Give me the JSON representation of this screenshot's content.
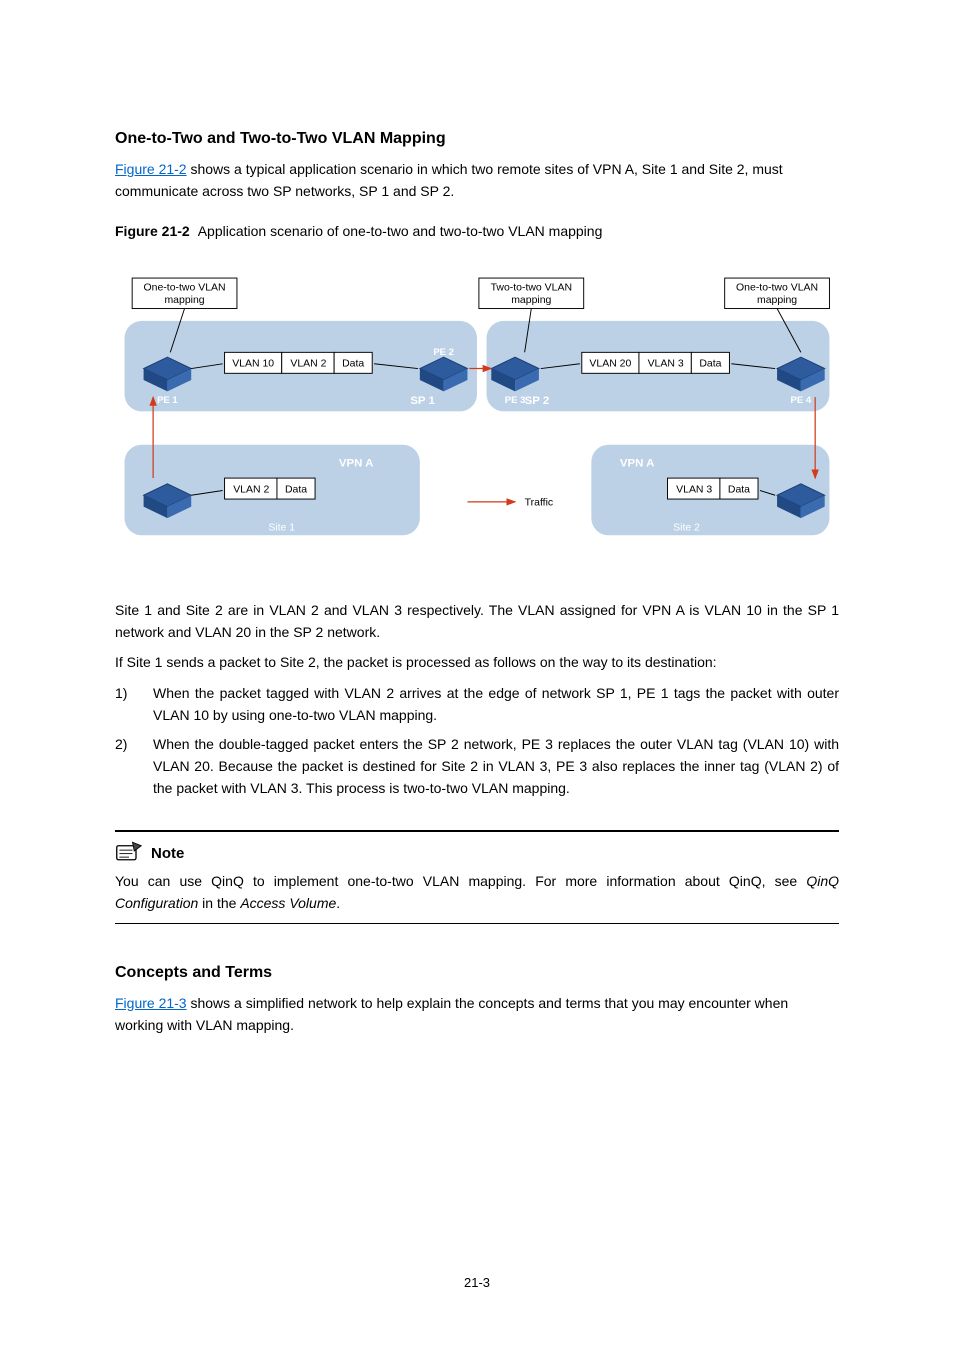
{
  "section_header": "One-to-Two and Two-to-Two VLAN Mapping",
  "intro": {
    "link_text": "Figure 21-2",
    "rest": " shows a typical application scenario in which two remote sites of VPN A, Site 1 and Site 2, must communicate across two SP networks, SP 1 and SP 2."
  },
  "figure": {
    "label": "Figure 21-2",
    "title": "Application scenario of one-to-two and two-to-two VLAN mapping"
  },
  "diagram": {
    "box1": {
      "l1": "One-to-two VLAN",
      "l2": "mapping"
    },
    "box2": {
      "l1": "Two-to-two VLAN",
      "l2": "mapping"
    },
    "box3": {
      "l1": "One-to-two VLAN",
      "l2": "mapping"
    },
    "pkt1": {
      "a": "VLAN 10",
      "b": "VLAN 2",
      "c": "Data"
    },
    "pkt2": {
      "a": "VLAN 20",
      "b": "VLAN 3",
      "c": "Data"
    },
    "pkt3": {
      "a": "VLAN 2",
      "b": "Data"
    },
    "pkt4": {
      "a": "VLAN 3",
      "b": "Data"
    },
    "sp1": "SP 1",
    "sp2": "SP 2",
    "vpnA1": "VPN A",
    "vpnA2": "VPN A",
    "pe1": "PE 1",
    "pe2": "PE 2",
    "pe3": "PE 3",
    "pe4": "PE 4",
    "site1": "Site 1",
    "site2": "Site 2",
    "traffic": "Traffic"
  },
  "after_fig": {
    "p1": "Site 1 and Site 2 are in VLAN 2 and VLAN 3 respectively. The VLAN assigned for VPN A is VLAN 10 in the SP 1 network and VLAN 20 in the SP 2 network.",
    "p2": "If Site 1 sends a packet to Site 2, the packet is processed as follows on the way to its destination:",
    "li1": "When the packet tagged with VLAN 2 arrives at the edge of network SP 1, PE 1 tags the packet with outer VLAN 10 by using one-to-two VLAN mapping.",
    "li2": "When the double-tagged packet enters the SP 2 network, PE 3 replaces the outer VLAN tag (VLAN 10) with VLAN 20. Because the packet is destined for Site 2 in VLAN 3, PE 3 also replaces the inner tag (VLAN 2) of the packet with VLAN 3. This process is two-to-two VLAN mapping."
  },
  "note": {
    "title": "Note",
    "body_pre": "You can use QinQ to implement one-to-two VLAN mapping. For more information about QinQ, see ",
    "body_italic1": "QinQ Configuration",
    "body_mid": " in the ",
    "body_italic2": "Access Volume",
    "body_post": "."
  },
  "concepts": {
    "header": "Concepts and Terms",
    "link_text": "Figure 21-3",
    "rest": " shows a simplified network to help explain the concepts and terms that you may encounter when working with VLAN mapping."
  },
  "page_num": "21-3",
  "chart_data": {
    "type": "diagram",
    "topology": {
      "upper_row": {
        "left_cloud": "SP 1",
        "right_cloud": "SP 2",
        "devices": [
          "PE 1",
          "PE 2",
          "PE 3",
          "PE 4"
        ],
        "callouts": [
          {
            "target": "PE 1",
            "text": "One-to-two VLAN mapping"
          },
          {
            "target": "PE 3",
            "text": "Two-to-two VLAN mapping"
          },
          {
            "target": "PE 4",
            "text": "One-to-two VLAN mapping"
          }
        ],
        "packets": [
          {
            "between": [
              "PE 1",
              "PE 2"
            ],
            "tags": [
              "VLAN 10",
              "VLAN 2",
              "Data"
            ]
          },
          {
            "between": [
              "PE 3",
              "PE 4"
            ],
            "tags": [
              "VLAN 20",
              "VLAN 3",
              "Data"
            ]
          }
        ]
      },
      "lower_row": {
        "left_cloud": "VPN A (Site 1)",
        "right_cloud": "VPN A (Site 2)",
        "packets": [
          {
            "at": "Site 1",
            "tags": [
              "VLAN 2",
              "Data"
            ]
          },
          {
            "at": "Site 2",
            "tags": [
              "VLAN 3",
              "Data"
            ]
          }
        ],
        "legend": {
          "label": "Traffic",
          "symbol": "arrow"
        }
      },
      "traffic_direction": "Site 1 -> PE 1 -> PE 2 -> PE 3 -> PE 4 -> Site 2"
    }
  }
}
